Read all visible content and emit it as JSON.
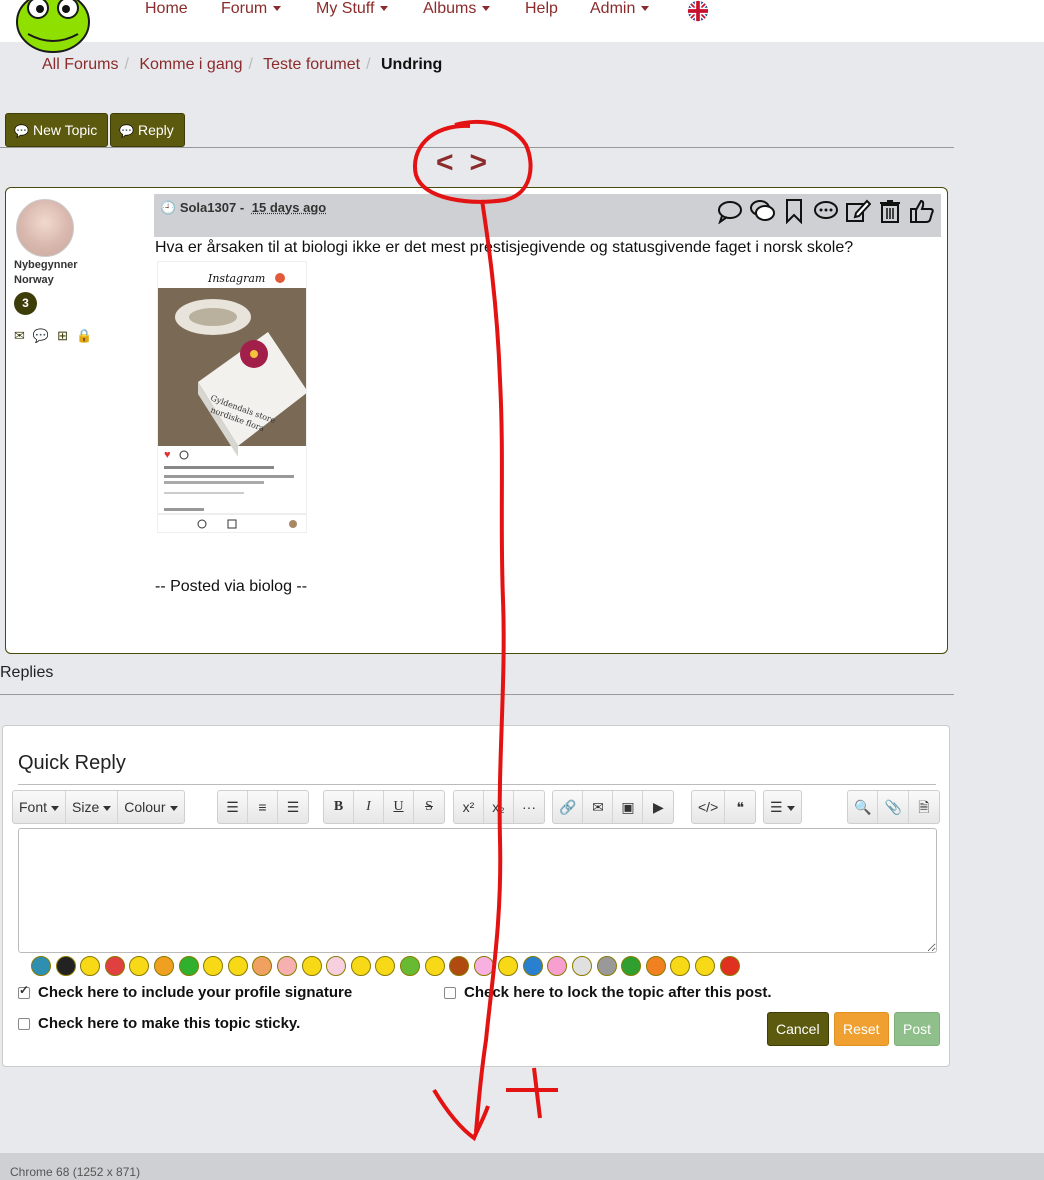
{
  "nav": {
    "items": [
      {
        "label": "Home",
        "dropdown": false
      },
      {
        "label": "Forum",
        "dropdown": true
      },
      {
        "label": "My Stuff",
        "dropdown": true
      },
      {
        "label": "Albums",
        "dropdown": true
      },
      {
        "label": "Help",
        "dropdown": false
      },
      {
        "label": "Admin",
        "dropdown": true
      }
    ],
    "language_icon": "uk-flag-icon"
  },
  "breadcrumb": {
    "items": [
      "All Forums",
      "Komme i gang",
      "Teste forumet"
    ],
    "current": "Undring"
  },
  "actions": {
    "new_topic": "New Topic",
    "reply": "Reply"
  },
  "pager": {
    "prev": "<",
    "next": ">"
  },
  "post": {
    "author": "Sola1307",
    "separator": "-",
    "time_ago": "15 days ago",
    "rank": "Nybegynner",
    "country": "Norway",
    "post_count": "3",
    "text": "Hva er årsaken til at biologi ikke er det mest prestisjegivende og statusgivende faget i norsk skole?",
    "signature": "-- Posted via biolog --",
    "image_app_title": "Instagram",
    "image_book_title": "Gyldendals store nordiske flora",
    "action_icons": [
      "quote-icon",
      "multi-quote-icon",
      "bookmark-icon",
      "comment-icon",
      "edit-icon",
      "delete-icon",
      "like-icon"
    ]
  },
  "replies_label": "Replies",
  "quick_reply": {
    "title": "Quick Reply",
    "toolbar": {
      "font": "Font",
      "size": "Size",
      "colour": "Colour"
    },
    "editor_value": "",
    "signature_checkbox": "Check here to include your profile signature",
    "signature_checked": true,
    "lock_checkbox": "Check here to lock the topic after this post.",
    "lock_checked": false,
    "sticky_checkbox": "Check here to make this topic sticky.",
    "sticky_checked": false,
    "cancel": "Cancel",
    "reset": "Reset",
    "post": "Post",
    "smiley_count": 29
  },
  "colors": {
    "accent_olive": "#5c5a0f",
    "link": "#8b2b2b",
    "reset_orange": "#f0a030",
    "post_green": "#8fbf8a",
    "annotation_red": "#e31313"
  },
  "footer": {
    "text": "Chrome 68 (1252 x 871)"
  }
}
